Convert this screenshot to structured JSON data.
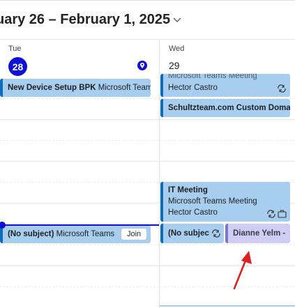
{
  "header": {
    "date_range": "uary 26 – February 1, 2025",
    "chevron_icon": "chevron-down-icon"
  },
  "days": [
    {
      "name": "Tue",
      "number": "28",
      "is_today": true
    },
    {
      "name": "Wed",
      "number": "29",
      "is_today": false
    }
  ],
  "events": {
    "tue_device_setup": {
      "title": "New Device Setup BPK",
      "detail": "Microsoft Teams"
    },
    "tue_no_subject": {
      "title": "(No subject)",
      "detail": "Microsoft Teams",
      "join_label": "Join"
    },
    "wed_teams_meeting": {
      "line1": "Microsoft Teams Meeting",
      "line2": "Hector Castro"
    },
    "wed_schultzteam": {
      "title": "Schultzteam.com Custom Domain"
    },
    "wed_it_meeting": {
      "title": "IT Meeting",
      "line1": "Microsoft Teams Meeting",
      "line2": "Hector Castro"
    },
    "wed_no_subject": {
      "title": "(No subject)"
    },
    "wed_dianne": {
      "title": "Dianne Yelm -"
    }
  },
  "colors": {
    "today_accent": "#0f0fd8",
    "event_fill": "#a7cdef",
    "event_bar": "#0f6cbd",
    "lavender_fill": "#cfcdf3",
    "annotation_arrow": "#e02020"
  }
}
